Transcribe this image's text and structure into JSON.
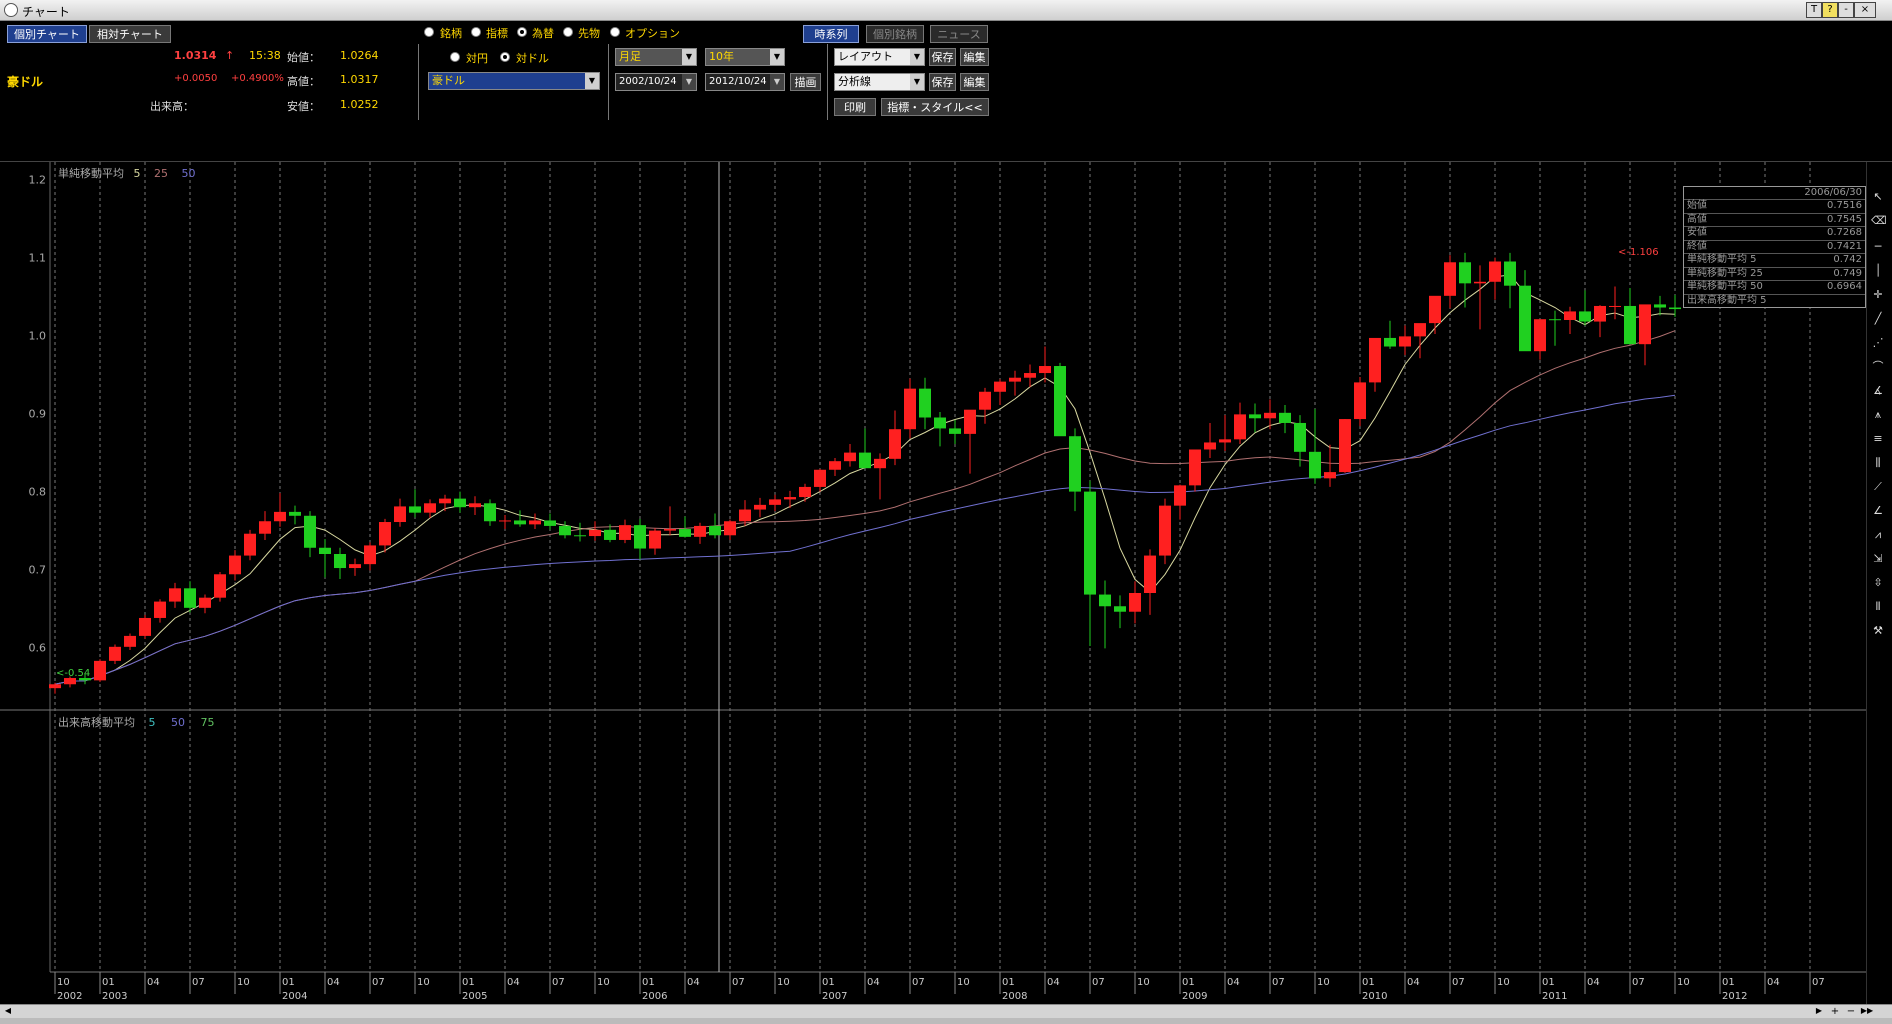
{
  "window": {
    "title": "チャート",
    "buttons": [
      "T",
      "?",
      "-",
      "×"
    ]
  },
  "tabs": {
    "individual": "個別チャート",
    "relative": "相対チャート"
  },
  "quote": {
    "symbol": "豪ドル",
    "price": "1.0314",
    "arrow": "↑",
    "time": "15:38",
    "change": "+0.0050",
    "change_pct": "+0.4900%",
    "volume_label": "出来高：",
    "open_label": "始値：",
    "open": "1.0264",
    "high_label": "高値：",
    "high": "1.0317",
    "low_label": "安値：",
    "low": "1.0252"
  },
  "asset_types": [
    {
      "label": "銘柄",
      "selected": false
    },
    {
      "label": "指標",
      "selected": false
    },
    {
      "label": "為替",
      "selected": true
    },
    {
      "label": "先物",
      "selected": false
    },
    {
      "label": "オプション",
      "selected": false
    }
  ],
  "quote_currency": [
    {
      "label": "対円",
      "selected": false
    },
    {
      "label": "対ドル",
      "selected": true
    }
  ],
  "pair_select": "豪ドル",
  "period_select": "月足",
  "span_select": "10年",
  "date_from": "2002/10/24",
  "date_to": "2012/10/24",
  "draw_button": "描画",
  "view_buttons": {
    "timeseries": "時系列",
    "individual_issue": "個別銘柄",
    "news": "ニュース"
  },
  "layout": {
    "select": "レイアウト",
    "save": "保存",
    "edit": "編集"
  },
  "analysis": {
    "select": "分析線",
    "save": "保存",
    "edit": "編集"
  },
  "print_button": "印刷",
  "style_button": "指標・スタイル<<",
  "price_panel": {
    "legend_title": "単純移動平均",
    "legend_periods": [
      "5",
      "25",
      "50"
    ],
    "yticks": [
      "1.2",
      "1.1",
      "1.0",
      "0.9",
      "0.8",
      "0.7",
      "0.6"
    ],
    "min_label": "<-0.54",
    "max_label": "<-1.106"
  },
  "volume_panel": {
    "legend_title": "出来高移動平均",
    "legend_periods": [
      "5",
      "50",
      "75"
    ]
  },
  "infobox": {
    "date": "2006/06/30",
    "rows": [
      {
        "k": "始値",
        "v": "0.7516"
      },
      {
        "k": "高値",
        "v": "0.7545"
      },
      {
        "k": "安値",
        "v": "0.7268"
      },
      {
        "k": "終値",
        "v": "0.7421"
      },
      {
        "k": "単純移動平均 5",
        "v": "0.742"
      },
      {
        "k": "単純移動平均 25",
        "v": "0.749"
      },
      {
        "k": "単純移動平均 50",
        "v": "0.6964"
      },
      {
        "k": "出来高移動平均 5",
        "v": ""
      }
    ]
  },
  "xaxis": {
    "month_labels": [
      "10",
      "01",
      "04",
      "07",
      "10",
      "01",
      "04",
      "07",
      "10",
      "01",
      "04",
      "07",
      "10",
      "01",
      "04",
      "07",
      "10",
      "01",
      "04",
      "07",
      "10",
      "01",
      "04",
      "07",
      "10",
      "01",
      "04",
      "07",
      "10",
      "01",
      "04",
      "07",
      "10",
      "01",
      "04",
      "07",
      "10",
      "01",
      "04",
      "07"
    ],
    "year_labels": [
      "2002",
      "2003",
      "2004",
      "2005",
      "2006",
      "2007",
      "2008",
      "2009",
      "2010",
      "2011",
      "2012"
    ]
  },
  "colors": {
    "up": "#ff2020",
    "down": "#20d020",
    "ma5": "#d8d8a0",
    "ma25": "#b07070",
    "ma50": "#7070d0"
  },
  "chart_data": {
    "type": "candlestick",
    "x_start": "2002-10",
    "frequency": "monthly",
    "ohlc": [
      [
        0.548,
        0.555,
        0.541,
        0.553
      ],
      [
        0.553,
        0.563,
        0.549,
        0.561
      ],
      [
        0.561,
        0.566,
        0.553,
        0.558
      ],
      [
        0.558,
        0.585,
        0.556,
        0.583
      ],
      [
        0.583,
        0.604,
        0.579,
        0.601
      ],
      [
        0.601,
        0.618,
        0.597,
        0.615
      ],
      [
        0.615,
        0.642,
        0.611,
        0.638
      ],
      [
        0.638,
        0.662,
        0.632,
        0.659
      ],
      [
        0.659,
        0.683,
        0.651,
        0.676
      ],
      [
        0.676,
        0.685,
        0.645,
        0.651
      ],
      [
        0.651,
        0.668,
        0.644,
        0.664
      ],
      [
        0.664,
        0.697,
        0.659,
        0.694
      ],
      [
        0.694,
        0.725,
        0.686,
        0.718
      ],
      [
        0.718,
        0.751,
        0.712,
        0.746
      ],
      [
        0.746,
        0.775,
        0.738,
        0.762
      ],
      [
        0.762,
        0.798,
        0.755,
        0.774
      ],
      [
        0.774,
        0.782,
        0.758,
        0.769
      ],
      [
        0.769,
        0.775,
        0.716,
        0.728
      ],
      [
        0.728,
        0.739,
        0.69,
        0.72
      ],
      [
        0.72,
        0.728,
        0.688,
        0.702
      ],
      [
        0.702,
        0.714,
        0.692,
        0.707
      ],
      [
        0.707,
        0.735,
        0.699,
        0.731
      ],
      [
        0.731,
        0.765,
        0.722,
        0.761
      ],
      [
        0.761,
        0.791,
        0.755,
        0.781
      ],
      [
        0.781,
        0.803,
        0.767,
        0.773
      ],
      [
        0.773,
        0.79,
        0.766,
        0.785
      ],
      [
        0.785,
        0.796,
        0.775,
        0.791
      ],
      [
        0.791,
        0.8,
        0.773,
        0.78
      ],
      [
        0.78,
        0.794,
        0.77,
        0.785
      ],
      [
        0.785,
        0.79,
        0.756,
        0.762
      ],
      [
        0.762,
        0.77,
        0.752,
        0.763
      ],
      [
        0.763,
        0.776,
        0.755,
        0.758
      ],
      [
        0.758,
        0.772,
        0.752,
        0.763
      ],
      [
        0.763,
        0.772,
        0.751,
        0.756
      ],
      [
        0.756,
        0.762,
        0.74,
        0.744
      ],
      [
        0.744,
        0.76,
        0.736,
        0.743
      ],
      [
        0.743,
        0.762,
        0.737,
        0.751
      ],
      [
        0.751,
        0.758,
        0.735,
        0.738
      ],
      [
        0.738,
        0.764,
        0.734,
        0.757
      ],
      [
        0.757,
        0.765,
        0.713,
        0.727
      ],
      [
        0.727,
        0.753,
        0.719,
        0.75
      ],
      [
        0.75,
        0.781,
        0.744,
        0.752
      ],
      [
        0.752,
        0.768,
        0.741,
        0.742
      ],
      [
        0.742,
        0.76,
        0.733,
        0.756
      ],
      [
        0.756,
        0.772,
        0.74,
        0.744
      ],
      [
        0.744,
        0.764,
        0.738,
        0.762
      ],
      [
        0.762,
        0.789,
        0.756,
        0.777
      ],
      [
        0.777,
        0.792,
        0.767,
        0.783
      ],
      [
        0.783,
        0.796,
        0.775,
        0.79
      ],
      [
        0.79,
        0.801,
        0.779,
        0.793
      ],
      [
        0.793,
        0.81,
        0.787,
        0.806
      ],
      [
        0.806,
        0.829,
        0.8,
        0.828
      ],
      [
        0.828,
        0.843,
        0.82,
        0.839
      ],
      [
        0.839,
        0.861,
        0.832,
        0.85
      ],
      [
        0.85,
        0.881,
        0.838,
        0.83
      ],
      [
        0.83,
        0.849,
        0.79,
        0.842
      ],
      [
        0.842,
        0.904,
        0.834,
        0.88
      ],
      [
        0.88,
        0.945,
        0.868,
        0.932
      ],
      [
        0.932,
        0.946,
        0.88,
        0.895
      ],
      [
        0.895,
        0.902,
        0.858,
        0.881
      ],
      [
        0.881,
        0.892,
        0.861,
        0.874
      ],
      [
        0.874,
        0.884,
        0.823,
        0.905
      ],
      [
        0.905,
        0.933,
        0.887,
        0.928
      ],
      [
        0.928,
        0.944,
        0.911,
        0.941
      ],
      [
        0.941,
        0.955,
        0.923,
        0.946
      ],
      [
        0.946,
        0.963,
        0.934,
        0.952
      ],
      [
        0.952,
        0.986,
        0.94,
        0.961
      ],
      [
        0.961,
        0.965,
        0.872,
        0.871
      ],
      [
        0.871,
        0.881,
        0.775,
        0.8
      ],
      [
        0.8,
        0.814,
        0.602,
        0.668
      ],
      [
        0.668,
        0.686,
        0.599,
        0.653
      ],
      [
        0.653,
        0.667,
        0.625,
        0.646
      ],
      [
        0.646,
        0.685,
        0.631,
        0.67
      ],
      [
        0.67,
        0.726,
        0.642,
        0.718
      ],
      [
        0.718,
        0.791,
        0.707,
        0.782
      ],
      [
        0.782,
        0.809,
        0.764,
        0.808
      ],
      [
        0.808,
        0.852,
        0.8,
        0.854
      ],
      [
        0.854,
        0.888,
        0.843,
        0.863
      ],
      [
        0.863,
        0.898,
        0.852,
        0.867
      ],
      [
        0.867,
        0.914,
        0.861,
        0.899
      ],
      [
        0.899,
        0.913,
        0.876,
        0.894
      ],
      [
        0.894,
        0.918,
        0.88,
        0.901
      ],
      [
        0.901,
        0.911,
        0.875,
        0.888
      ],
      [
        0.888,
        0.898,
        0.832,
        0.851
      ],
      [
        0.851,
        0.906,
        0.81,
        0.817
      ],
      [
        0.817,
        0.86,
        0.806,
        0.825
      ],
      [
        0.825,
        0.893,
        0.824,
        0.893
      ],
      [
        0.893,
        0.947,
        0.884,
        0.94
      ],
      [
        0.94,
        0.995,
        0.928,
        0.997
      ],
      [
        0.997,
        1.019,
        0.983,
        0.986
      ],
      [
        0.986,
        1.013,
        0.975,
        0.999
      ],
      [
        0.999,
        1.008,
        0.971,
        1.016
      ],
      [
        1.016,
        1.046,
        1.002,
        1.051
      ],
      [
        1.051,
        1.103,
        1.035,
        1.094
      ],
      [
        1.094,
        1.106,
        1.036,
        1.067
      ],
      [
        1.067,
        1.09,
        1.008,
        1.069
      ],
      [
        1.069,
        1.1,
        1.046,
        1.095
      ],
      [
        1.095,
        1.106,
        1.035,
        1.064
      ],
      [
        1.064,
        1.084,
        0.985,
        0.98
      ],
      [
        0.98,
        1.011,
        0.969,
        1.021
      ],
      [
        1.021,
        1.032,
        0.987,
        1.02
      ],
      [
        1.02,
        1.037,
        1.002,
        1.031
      ],
      [
        1.031,
        1.058,
        1.013,
        1.018
      ],
      [
        1.018,
        1.039,
        0.998,
        1.038
      ],
      [
        1.038,
        1.063,
        1.021,
        1.038
      ],
      [
        1.038,
        1.061,
        0.996,
        0.989
      ],
      [
        0.989,
        1.039,
        0.962,
        1.04
      ],
      [
        1.04,
        1.051,
        1.026,
        1.036
      ],
      [
        1.036,
        1.052,
        1.024,
        1.034
      ]
    ],
    "ylim": [
      0.52,
      1.22
    ]
  }
}
